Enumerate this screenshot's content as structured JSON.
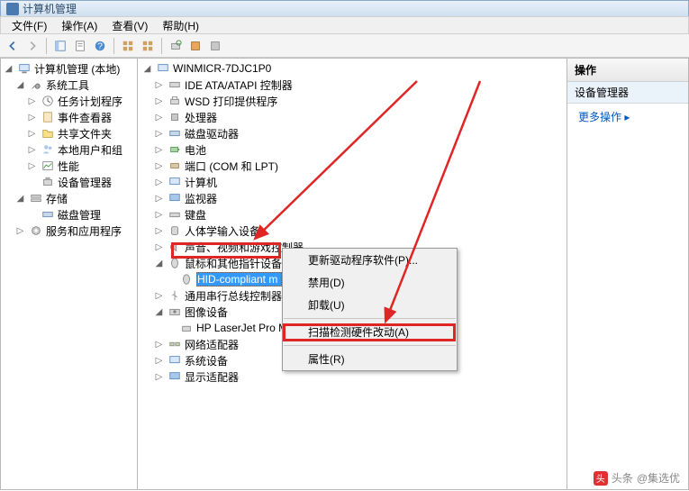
{
  "window": {
    "title": "计算机管理"
  },
  "menu": {
    "file": "文件(F)",
    "action": "操作(A)",
    "view": "查看(V)",
    "help": "帮助(H)"
  },
  "left_tree": {
    "root": "计算机管理 (本地)",
    "g1": "系统工具",
    "g1_items": [
      "任务计划程序",
      "事件查看器",
      "共享文件夹",
      "本地用户和组",
      "性能",
      "设备管理器"
    ],
    "g2": "存储",
    "g2_items": [
      "磁盘管理"
    ],
    "g3": "服务和应用程序"
  },
  "device_tree": {
    "root": "WINMICR-7DJC1P0",
    "items": [
      "IDE ATA/ATAPI 控制器",
      "WSD 打印提供程序",
      "处理器",
      "磁盘驱动器",
      "电池",
      "端口 (COM 和 LPT)",
      "计算机",
      "监视器",
      "键盘",
      "人体学输入设备",
      "声音、视频和游戏控制器",
      "鼠标和其他指针设备",
      "通用串行总线控制器",
      "图像设备",
      "网络适配器",
      "系统设备",
      "显示适配器"
    ],
    "mouse_child": "HID-compliant m",
    "image_child": "HP LaserJet Pro M"
  },
  "context_menu": {
    "update": "更新驱动程序软件(P)...",
    "disable": "禁用(D)",
    "uninstall": "卸载(U)",
    "scan": "扫描检测硬件改动(A)",
    "props": "属性(R)"
  },
  "actions": {
    "header": "操作",
    "sub": "设备管理器",
    "more": "更多操作"
  },
  "watermark": {
    "brand": "头条",
    "user": "@集选优"
  },
  "status": ""
}
